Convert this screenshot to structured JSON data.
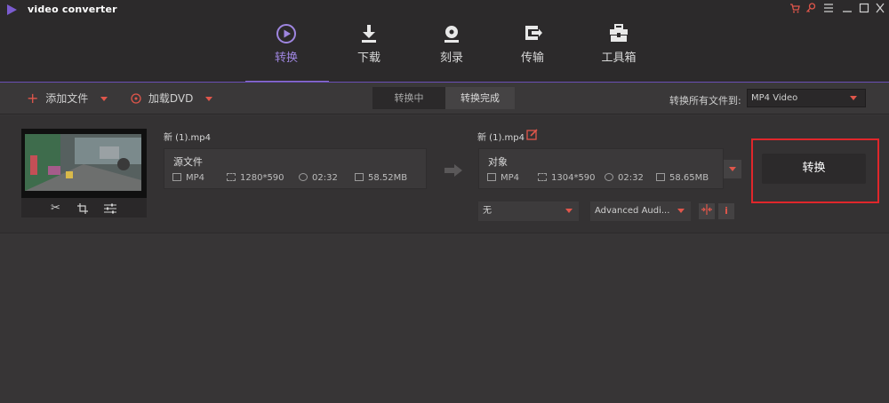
{
  "app": {
    "title": "video converter"
  },
  "nav": {
    "tabs": [
      {
        "label": "转换",
        "icon": "play-circle-icon"
      },
      {
        "label": "下载",
        "icon": "download-icon"
      },
      {
        "label": "刻录",
        "icon": "disc-icon"
      },
      {
        "label": "传输",
        "icon": "transfer-icon"
      },
      {
        "label": "工具箱",
        "icon": "toolbox-icon"
      }
    ],
    "active": "转换"
  },
  "toolbar": {
    "add_file": "添加文件",
    "load_dvd": "加载DVD",
    "segment": [
      "转换中",
      "转换完成"
    ],
    "convert_all_label": "转换所有文件到:",
    "format": "MP4 Video"
  },
  "file": {
    "source_name": "新 (1).mp4",
    "target_name": "新 (1).mp4",
    "source": {
      "title": "源文件",
      "format": "MP4",
      "resolution": "1280*590",
      "duration": "02:32",
      "size": "58.52MB"
    },
    "target": {
      "title": "对象",
      "format": "MP4",
      "resolution": "1304*590",
      "duration": "02:32",
      "size": "58.65MB"
    },
    "subtitle": "无",
    "audio": "Advanced Audi...",
    "convert_button": "转换"
  },
  "colors": {
    "accent": "#8d6fd6",
    "highlight": "#e0262b",
    "orange": "#e0564b"
  }
}
